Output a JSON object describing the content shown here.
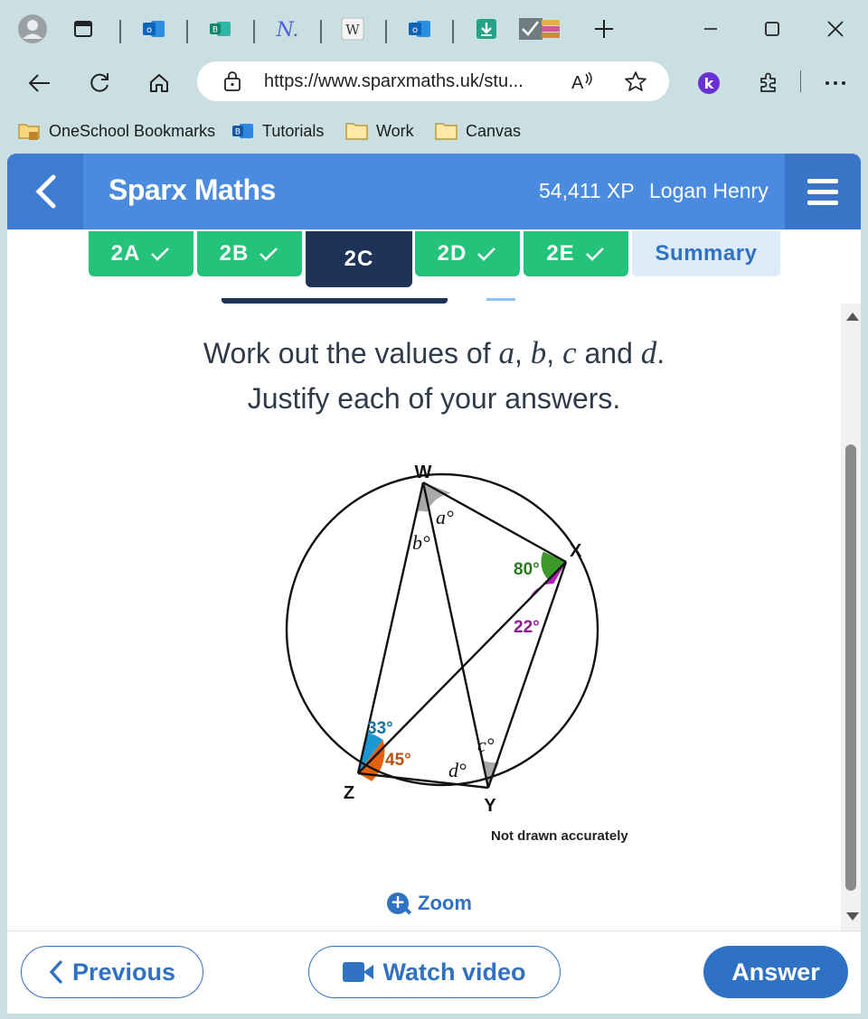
{
  "browser": {
    "url": "https://www.sparxmaths.uk/stu...",
    "bookmarks": [
      {
        "label": "OneSchool Bookmarks",
        "icon": "folder-lock-icon"
      },
      {
        "label": "Tutorials",
        "icon": "bookings-icon"
      },
      {
        "label": "Work",
        "icon": "folder-icon"
      },
      {
        "label": "Canvas",
        "icon": "folder-icon"
      }
    ],
    "tabs": [
      {
        "icon": "outlook-icon"
      },
      {
        "icon": "bookings-icon"
      },
      {
        "icon": "n-icon"
      },
      {
        "icon": "wikipedia-icon"
      },
      {
        "icon": "outlook-icon"
      },
      {
        "icon": "download-icon"
      },
      {
        "icon": "checklist-icon"
      }
    ],
    "colors": {
      "chrome": "#c9dfe1",
      "accent": "#2f72c4"
    }
  },
  "app": {
    "brand": "Sparx Maths",
    "xp": "54,411 XP",
    "user": "Logan Henry",
    "colors": {
      "header": "#4a8bdf",
      "done": "#24c37a",
      "active": "#1f3358"
    }
  },
  "tasks": [
    {
      "label": "2A",
      "state": "done"
    },
    {
      "label": "2B",
      "state": "done"
    },
    {
      "label": "2C",
      "state": "active"
    },
    {
      "label": "2D",
      "state": "done"
    },
    {
      "label": "2E",
      "state": "done"
    },
    {
      "label": "Summary",
      "state": "summary"
    }
  ],
  "question": {
    "line1_prefix": "Work out the values of ",
    "var_a": "a",
    "var_b": "b",
    "var_c": "c",
    "var_d": "d",
    "and": " and ",
    "comma": ",",
    "period": ".",
    "line2": "Justify each of your answers."
  },
  "diagram": {
    "points": {
      "W": "W",
      "X": "X",
      "Y": "Y",
      "Z": "Z"
    },
    "angles": {
      "a": "a°",
      "b": "b°",
      "c": "c°",
      "d": "d°",
      "x_top": "80°",
      "x_bottom": "22°",
      "z_top": "33°",
      "z_bottom": "45°"
    },
    "note": "Not drawn accurately",
    "colors": {
      "green": "#3d9a2a",
      "magenta": "#b21fb8",
      "blue": "#1b97d3",
      "orange": "#e2620f",
      "grey": "#a9a9a9"
    }
  },
  "actions": {
    "zoom": "Zoom",
    "previous": "Previous",
    "watch_video": "Watch video",
    "answer": "Answer"
  }
}
